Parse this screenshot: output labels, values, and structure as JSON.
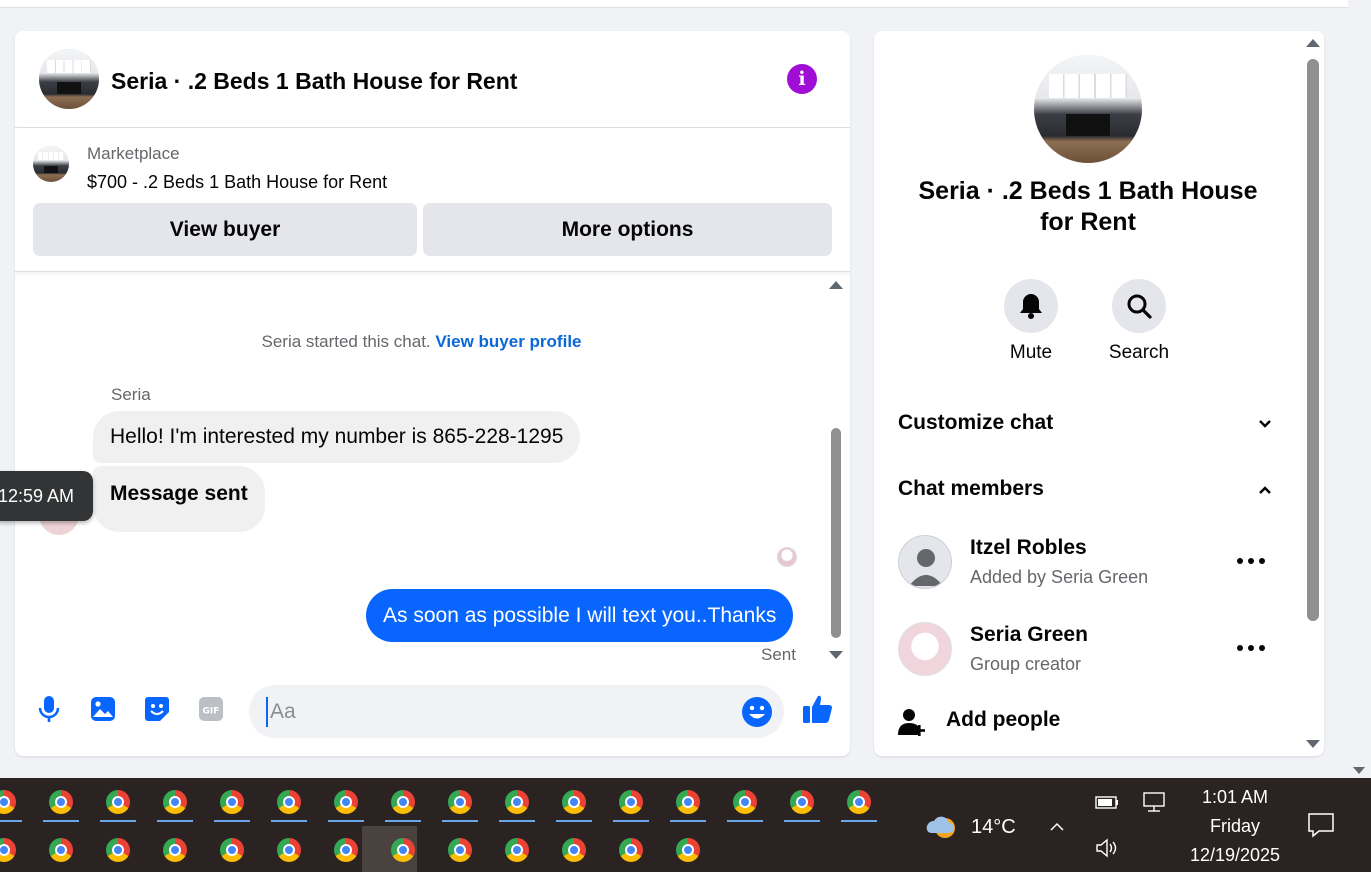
{
  "chat": {
    "title": "Seria · .2 Beds 1 Bath House for Rent",
    "marketplace_label": "Marketplace",
    "listing": "$700 - .2 Beds 1 Bath House for Rent",
    "view_buyer": "View buyer",
    "more_options": "More options",
    "system_text": "Seria started this chat.",
    "system_link": "View buyer profile",
    "sender": "Seria",
    "messages_in": [
      "Hello! I'm interested my number is 865-228-1295",
      "Message sent"
    ],
    "message_out": "As soon as possible I will text you..Thanks",
    "sent_label": "Sent",
    "tooltip_time": "12:59 AM",
    "composer_placeholder": "Aa"
  },
  "side": {
    "title": "Seria · .2 Beds 1 Bath House for Rent",
    "mute": "Mute",
    "search": "Search",
    "customize": "Customize chat",
    "members_header": "Chat members",
    "members": [
      {
        "name": "Itzel Robles",
        "sub": "Added by Seria Green"
      },
      {
        "name": "Seria Green",
        "sub": "Group creator"
      }
    ],
    "add_people": "Add people"
  },
  "taskbar": {
    "temp": "14°C",
    "time": "1:01 AM",
    "day": "Friday",
    "date": "12/19/2025"
  },
  "colors": {
    "accent_blue": "#0866ff",
    "info_purple": "#a00ed6",
    "link_blue": "#0a68d8"
  }
}
